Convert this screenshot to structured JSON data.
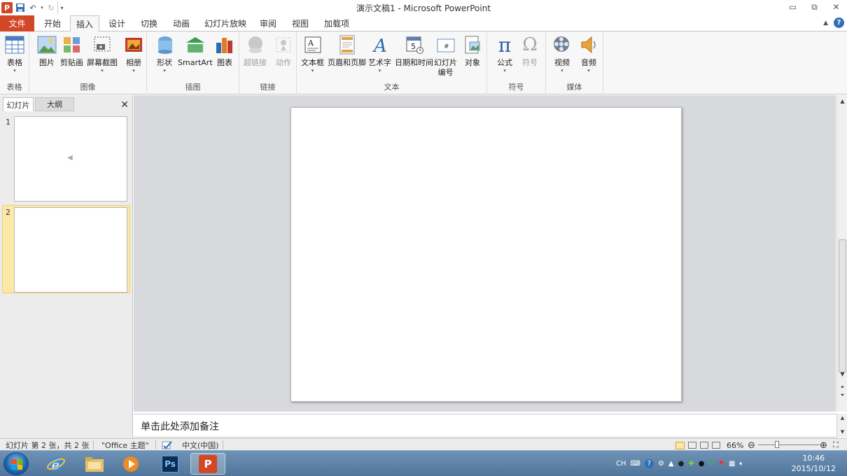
{
  "window": {
    "title": "演示文稿1  -  Microsoft PowerPoint"
  },
  "tabs": {
    "file": "文件",
    "items": [
      "开始",
      "插入",
      "设计",
      "切换",
      "动画",
      "幻灯片放映",
      "审阅",
      "视图",
      "加载项"
    ],
    "active": "插入"
  },
  "ribbon": {
    "groups": {
      "tables": "表格",
      "images": "图像",
      "illustrations": "插图",
      "links": "链接",
      "text": "文本",
      "symbols": "符号",
      "media": "媒体"
    },
    "buttons": {
      "table": "表格",
      "picture": "图片",
      "clipart": "剪贴画",
      "screenshot": "屏幕截图",
      "album": "相册",
      "shapes": "形状",
      "smartart": "SmartArt",
      "chart": "图表",
      "hyperlink": "超链接",
      "action": "动作",
      "textbox": "文本框",
      "header_footer": "页眉和页脚",
      "wordart": "艺术字",
      "datetime": "日期和时间",
      "slide_number_1": "幻灯片",
      "slide_number_2": "编号",
      "object": "对象",
      "equation": "公式",
      "symbol": "符号",
      "video": "视频",
      "audio": "音频"
    },
    "colors": {
      "accent": "#d24726",
      "icon_blue": "#2b6cb0"
    }
  },
  "left_pane": {
    "tab_slides": "幻灯片",
    "tab_outline": "大纲",
    "slides": [
      {
        "number": "1"
      },
      {
        "number": "2"
      }
    ]
  },
  "notes": {
    "placeholder": "单击此处添加备注"
  },
  "statusbar": {
    "slide_info": "幻灯片 第 2 张，共 2 张",
    "theme": "\"Office 主题\"",
    "language": "中文(中国)",
    "zoom": "66%"
  },
  "taskbar": {
    "tray_lang": "CH",
    "time": "10:46",
    "date": "2015/10/12"
  }
}
